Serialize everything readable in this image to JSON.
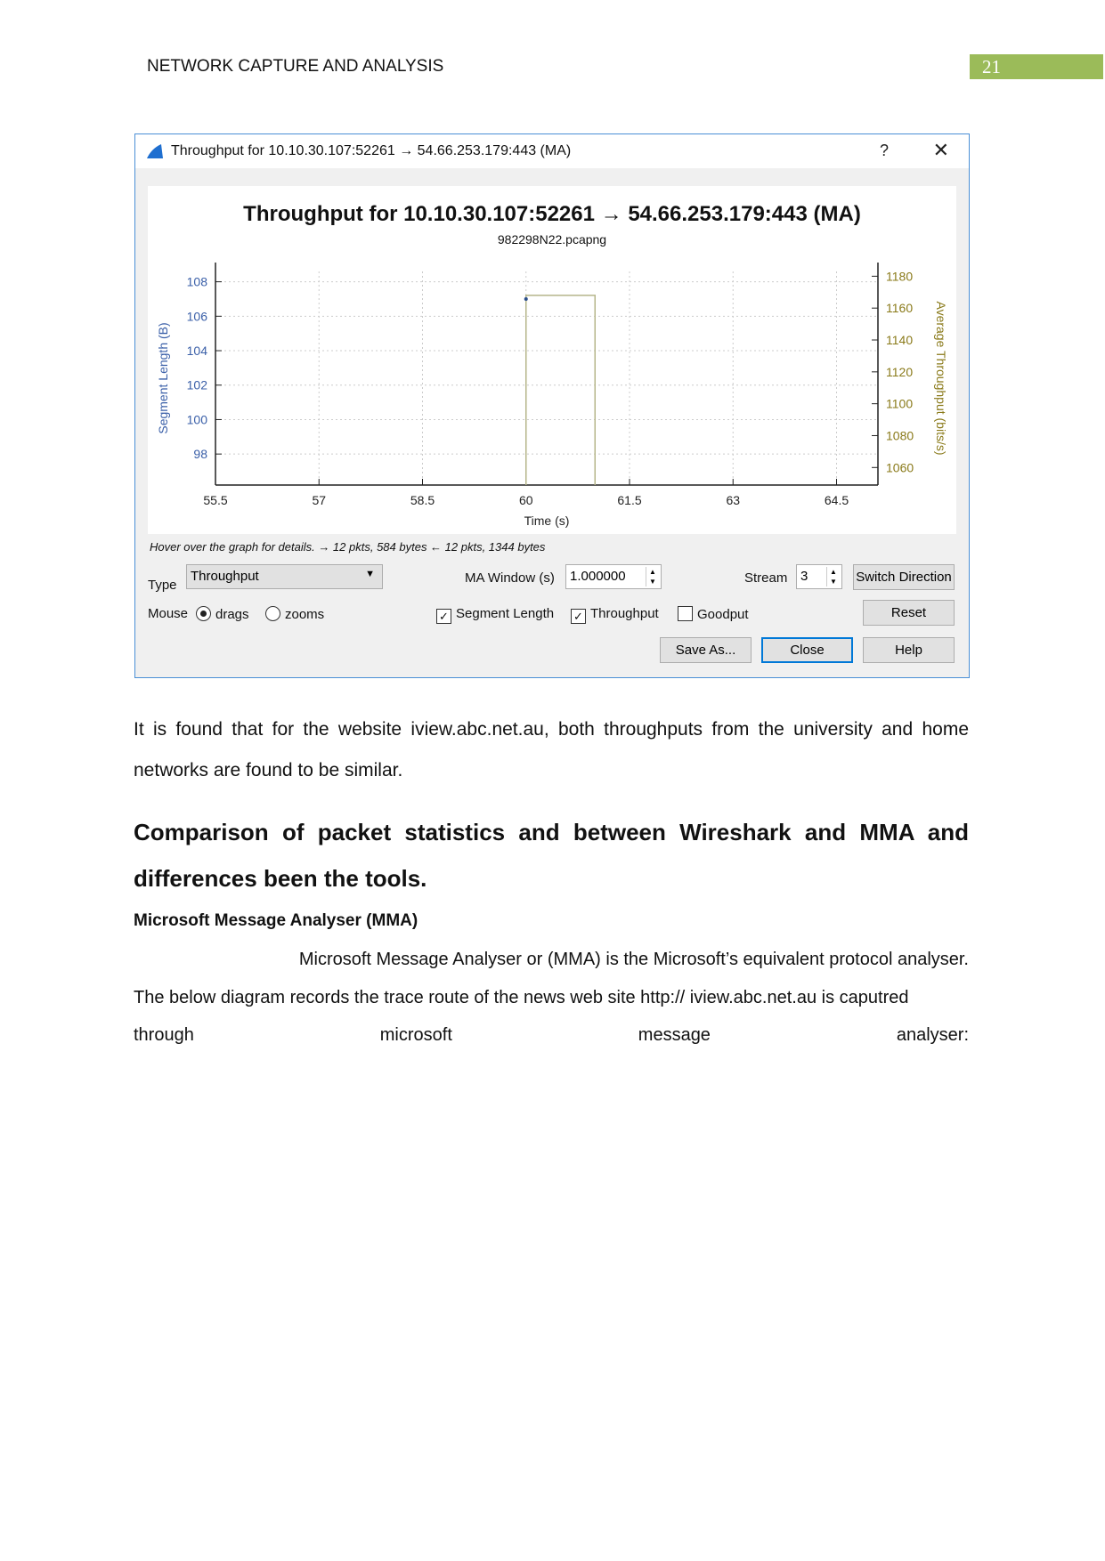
{
  "header": {
    "title": "NETWORK CAPTURE AND ANALYSIS",
    "page_number": "21",
    "accent": "#9bbb59"
  },
  "dialog": {
    "window_title": "Throughput for 10.10.30.107:52261 → 54.66.253.179:443 (MA)",
    "help_label": "?",
    "close_icon": "close-icon",
    "app_icon": "wireshark-fin-icon",
    "hover_text": "Hover over the graph for details. → 12 pkts, 584 bytes ← 12 pkts, 1344 bytes",
    "type_label": "Type",
    "type_value": "Throughput",
    "ma_label": "MA Window (s)",
    "ma_value": "1.000000",
    "stream_label": "Stream",
    "stream_value": "3",
    "switch_label": "Switch Direction",
    "mouse_label": "Mouse",
    "drags_label": "drags",
    "zooms_label": "zooms",
    "mouse_mode": "drags",
    "seg_label": "Segment Length",
    "seg_checked": true,
    "thr_label": "Throughput",
    "thr_checked": true,
    "good_label": "Goodput",
    "good_checked": false,
    "reset_label": "Reset",
    "save_label": "Save As...",
    "close_label": "Close",
    "help_btn_label": "Help"
  },
  "chart_data": {
    "type": "line",
    "title": "Throughput for 10.10.30.107:52261 → 54.66.253.179:443 (MA)",
    "subtitle": "982298N22.pcapng",
    "xlabel": "Time (s)",
    "ylabel": "Segment Length (B)",
    "y2label": "Average Throughput (bits/s)",
    "xlim": [
      55.5,
      65.1
    ],
    "ylim": [
      96.2,
      108.6
    ],
    "y2lim": [
      1049,
      1183
    ],
    "xticks": [
      "55.5",
      "57",
      "58.5",
      "60",
      "61.5",
      "63",
      "64.5"
    ],
    "yticks": [
      "98",
      "100",
      "102",
      "104",
      "106",
      "108"
    ],
    "y2ticks": [
      "1060",
      "1080",
      "1100",
      "1120",
      "1140",
      "1160",
      "1180"
    ],
    "grid": true,
    "colors": {
      "segment": "#2c4f8a",
      "throughput": "#b5b58a",
      "left_axis": "#3a5fa8",
      "right_axis": "#8a7a1a"
    },
    "segment_points": [
      {
        "x": 60,
        "y": 107
      }
    ],
    "throughput_line": [
      {
        "x": 60,
        "y": 1049
      },
      {
        "x": 60,
        "y": 1168
      },
      {
        "x": 61,
        "y": 1168
      },
      {
        "x": 61,
        "y": 1049
      }
    ]
  },
  "body": {
    "p1": "It is found that for the website iview.abc.net.au, both throughputs from the university and home networks are found to be similar.",
    "h2": "Comparison of packet statistics and between Wireshark and MMA and differences been the tools.",
    "h3": "Microsoft Message Analyser (MMA)",
    "p2a": "Microsoft Message Analyser or (MMA) is the Microsoft’s equivalent protocol analyser.",
    "p2b": "The  below diagram records the trace route of the news web site http:// iview.abc.net.au is caputred",
    "p2c": [
      "through",
      "microsoft",
      "message",
      "analyser:"
    ]
  }
}
